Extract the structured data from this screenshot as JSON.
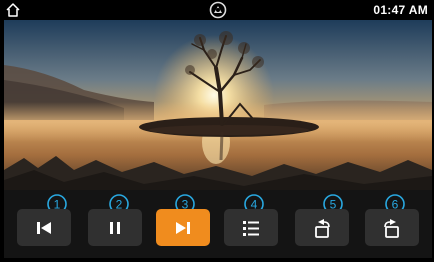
{
  "status_bar": {
    "time": "01:47 AM",
    "home_icon": "home-icon",
    "center_icon": "app-logo-icon"
  },
  "controls": [
    {
      "callout": "①",
      "icon": "skip-previous-icon",
      "active": false
    },
    {
      "callout": "②",
      "icon": "pause-icon",
      "active": false
    },
    {
      "callout": "③",
      "icon": "skip-next-icon",
      "active": true
    },
    {
      "callout": "④",
      "icon": "playlist-icon",
      "active": false
    },
    {
      "callout": "⑤",
      "icon": "rotate-left-icon",
      "active": false
    },
    {
      "callout": "⑥",
      "icon": "rotate-right-icon",
      "active": false
    }
  ],
  "colors": {
    "active": "#f08c1e",
    "button": "#303030",
    "callout": "#29a8e0",
    "bar": "#141414"
  }
}
